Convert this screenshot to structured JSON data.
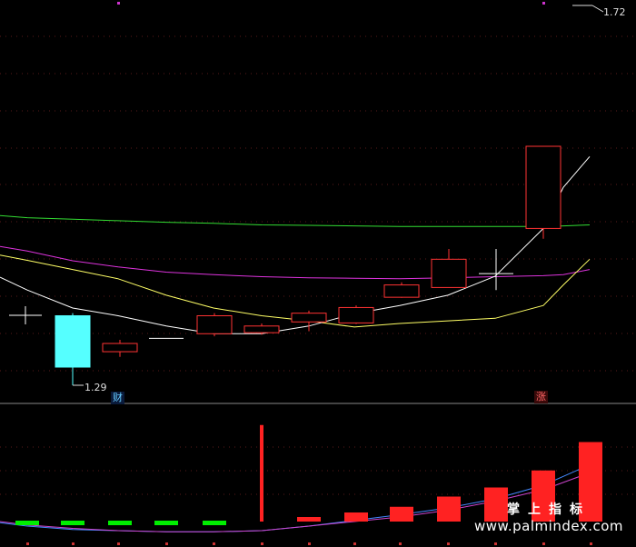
{
  "chart_data": {
    "type": "candlestick",
    "main_panel": {
      "price_high_label": "1.72",
      "price_low_label": "1.29",
      "candles": [
        {
          "open": 1.39,
          "close": 1.29,
          "high": 1.395,
          "low": 1.265,
          "color": "#55ffff"
        },
        {
          "open": 1.32,
          "close": 1.336,
          "high": 1.343,
          "low": 1.31,
          "color": "#ff3333"
        },
        {
          "open": 1.346,
          "close": 1.346,
          "high": 1.346,
          "low": 1.346,
          "color": "#ffffff"
        },
        {
          "open": 1.355,
          "close": 1.39,
          "high": 1.395,
          "low": 1.35,
          "color": "#ff3333"
        },
        {
          "open": 1.357,
          "close": 1.37,
          "high": 1.375,
          "low": 1.353,
          "color": "#ff3333"
        },
        {
          "open": 1.378,
          "close": 1.395,
          "high": 1.4,
          "low": 1.36,
          "color": "#ff3333"
        },
        {
          "open": 1.376,
          "close": 1.406,
          "high": 1.41,
          "low": 1.374,
          "color": "#ff3333"
        },
        {
          "open": 1.426,
          "close": 1.45,
          "high": 1.455,
          "low": 1.425,
          "color": "#ff3333"
        },
        {
          "open": 1.445,
          "close": 1.5,
          "high": 1.52,
          "low": 1.445,
          "color": "#ff3333"
        },
        {
          "open": 1.472,
          "close": 1.472,
          "high": 1.52,
          "low": 1.44,
          "color": "#ffffff"
        },
        {
          "open": 1.56,
          "close": 1.72,
          "high": 1.72,
          "low": 1.54,
          "color": "#ff3333"
        }
      ],
      "ma_lines": [
        {
          "color": "#33dd33",
          "values": [
            1.585,
            1.581,
            1.578,
            1.575,
            1.572,
            1.57,
            1.567,
            1.566,
            1.565,
            1.564,
            1.564,
            1.564,
            1.564,
            1.565,
            1.567
          ]
        },
        {
          "color": "#dd33dd",
          "values": [
            1.525,
            1.516,
            1.497,
            1.485,
            1.475,
            1.47,
            1.466,
            1.464,
            1.463,
            1.462,
            1.464,
            1.466,
            1.468,
            1.47,
            1.48
          ]
        },
        {
          "color": "#ffff66",
          "values": [
            1.508,
            1.498,
            1.48,
            1.462,
            1.43,
            1.405,
            1.39,
            1.38,
            1.368,
            1.375,
            1.38,
            1.385,
            1.41,
            1.45,
            1.5
          ]
        },
        {
          "color": "#ffffff",
          "values": [
            1.465,
            1.44,
            1.405,
            1.39,
            1.37,
            1.355,
            1.355,
            1.37,
            1.394,
            1.41,
            1.43,
            1.467,
            1.56,
            1.64,
            1.7
          ]
        }
      ]
    },
    "sub_panel": {
      "bars": [
        {
          "value": -0.8,
          "color": "#00ee00"
        },
        {
          "value": -0.9,
          "color": "#00ee00"
        },
        {
          "value": -0.7,
          "color": "#00ee00"
        },
        {
          "value": -0.6,
          "color": "#00ee00"
        },
        {
          "value": -0.3,
          "color": "#00ee00"
        },
        {
          "value": 8.5,
          "color": "#ff2222"
        },
        {
          "value": 0.4,
          "color": "#ff2222"
        },
        {
          "value": 0.8,
          "color": "#ff2222"
        },
        {
          "value": 1.3,
          "color": "#ff2222"
        },
        {
          "value": 2.2,
          "color": "#ff2222"
        },
        {
          "value": 3.0,
          "color": "#ff2222"
        },
        {
          "value": 4.5,
          "color": "#ff2222"
        },
        {
          "value": 7.0,
          "color": "#ff2222"
        }
      ],
      "lines": [
        {
          "color": "#4488ff",
          "values": [
            -0.1,
            -0.4,
            -0.7,
            -0.8,
            -0.9,
            -0.9,
            -0.8,
            -0.4,
            0.1,
            0.6,
            1.2,
            2.0,
            3.2,
            5.0
          ]
        },
        {
          "color": "#cc44cc",
          "values": [
            0.0,
            -0.3,
            -0.6,
            -0.8,
            -0.9,
            -0.9,
            -0.8,
            -0.4,
            0.0,
            0.4,
            1.0,
            1.8,
            2.8,
            4.3
          ]
        }
      ]
    }
  },
  "badges": {
    "cai": "财",
    "zhang": "涨"
  },
  "watermark": {
    "top": "掌上指标",
    "bottom": "www.palmindex.com"
  }
}
